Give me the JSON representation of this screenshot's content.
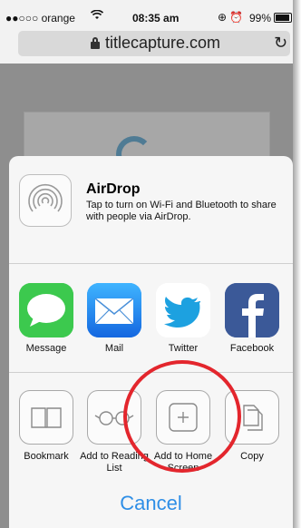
{
  "status_bar": {
    "carrier": "●●○○○ orange",
    "time": "08:35 am",
    "battery": "99%"
  },
  "address_bar": {
    "url": "titlecapture.com"
  },
  "airdrop": {
    "title": "AirDrop",
    "description": "Tap to turn on Wi-Fi and Bluetooth to share with people via AirDrop."
  },
  "apps": [
    {
      "label": "Message",
      "icon": "message-icon",
      "color": "#37c84a"
    },
    {
      "label": "Mail",
      "icon": "mail-icon",
      "color": "#1e8ef0"
    },
    {
      "label": "Twitter",
      "icon": "twitter-icon",
      "color": "#ffffff"
    },
    {
      "label": "Facebook",
      "icon": "facebook-icon",
      "color": "#3b5998"
    }
  ],
  "actions": [
    {
      "label": "Bookmark",
      "icon": "book-icon"
    },
    {
      "label": "Add to Reading List",
      "icon": "glasses-icon"
    },
    {
      "label": "Add to Home Screen",
      "icon": "plus-icon"
    },
    {
      "label": "Copy",
      "icon": "copy-icon"
    }
  ],
  "cancel_label": "Cancel",
  "highlight_color": "#e3262d"
}
